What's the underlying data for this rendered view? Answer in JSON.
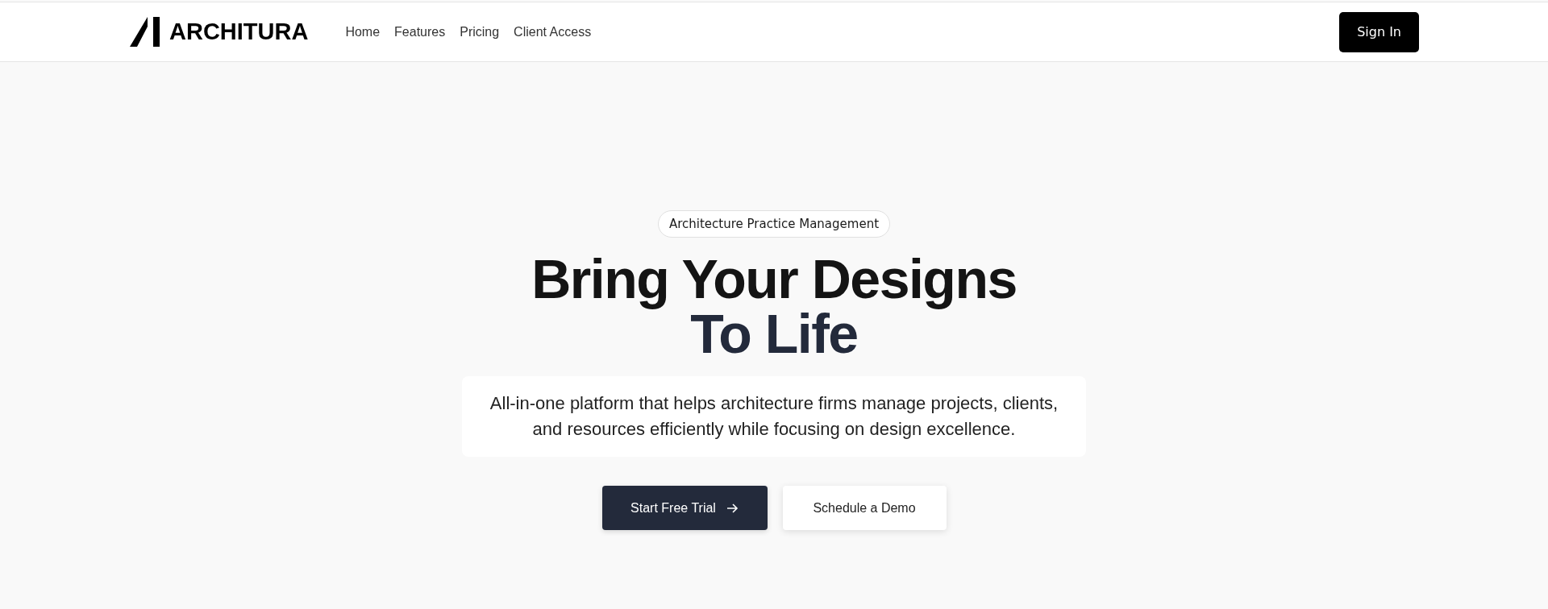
{
  "header": {
    "logo": "ARCHITURA",
    "nav": [
      {
        "label": "Home"
      },
      {
        "label": "Features"
      },
      {
        "label": "Pricing"
      },
      {
        "label": "Client Access"
      }
    ],
    "sign_in": "Sign In"
  },
  "hero": {
    "badge": "Architecture Practice Management",
    "headline": [
      {
        "text": "Bring Your Designs",
        "kind": "plain"
      },
      {
        "text": "To Life",
        "kind": "accent"
      }
    ],
    "subtitle": "All-in-one platform that helps architecture firms manage projects, clients, and resources efficiently while focusing on design excellence.",
    "buttons": [
      {
        "label": "Start Free Trial",
        "kind": "primary",
        "arrow": true
      },
      {
        "label": "Schedule a Demo",
        "kind": "secondary",
        "arrow": false
      }
    ]
  }
}
